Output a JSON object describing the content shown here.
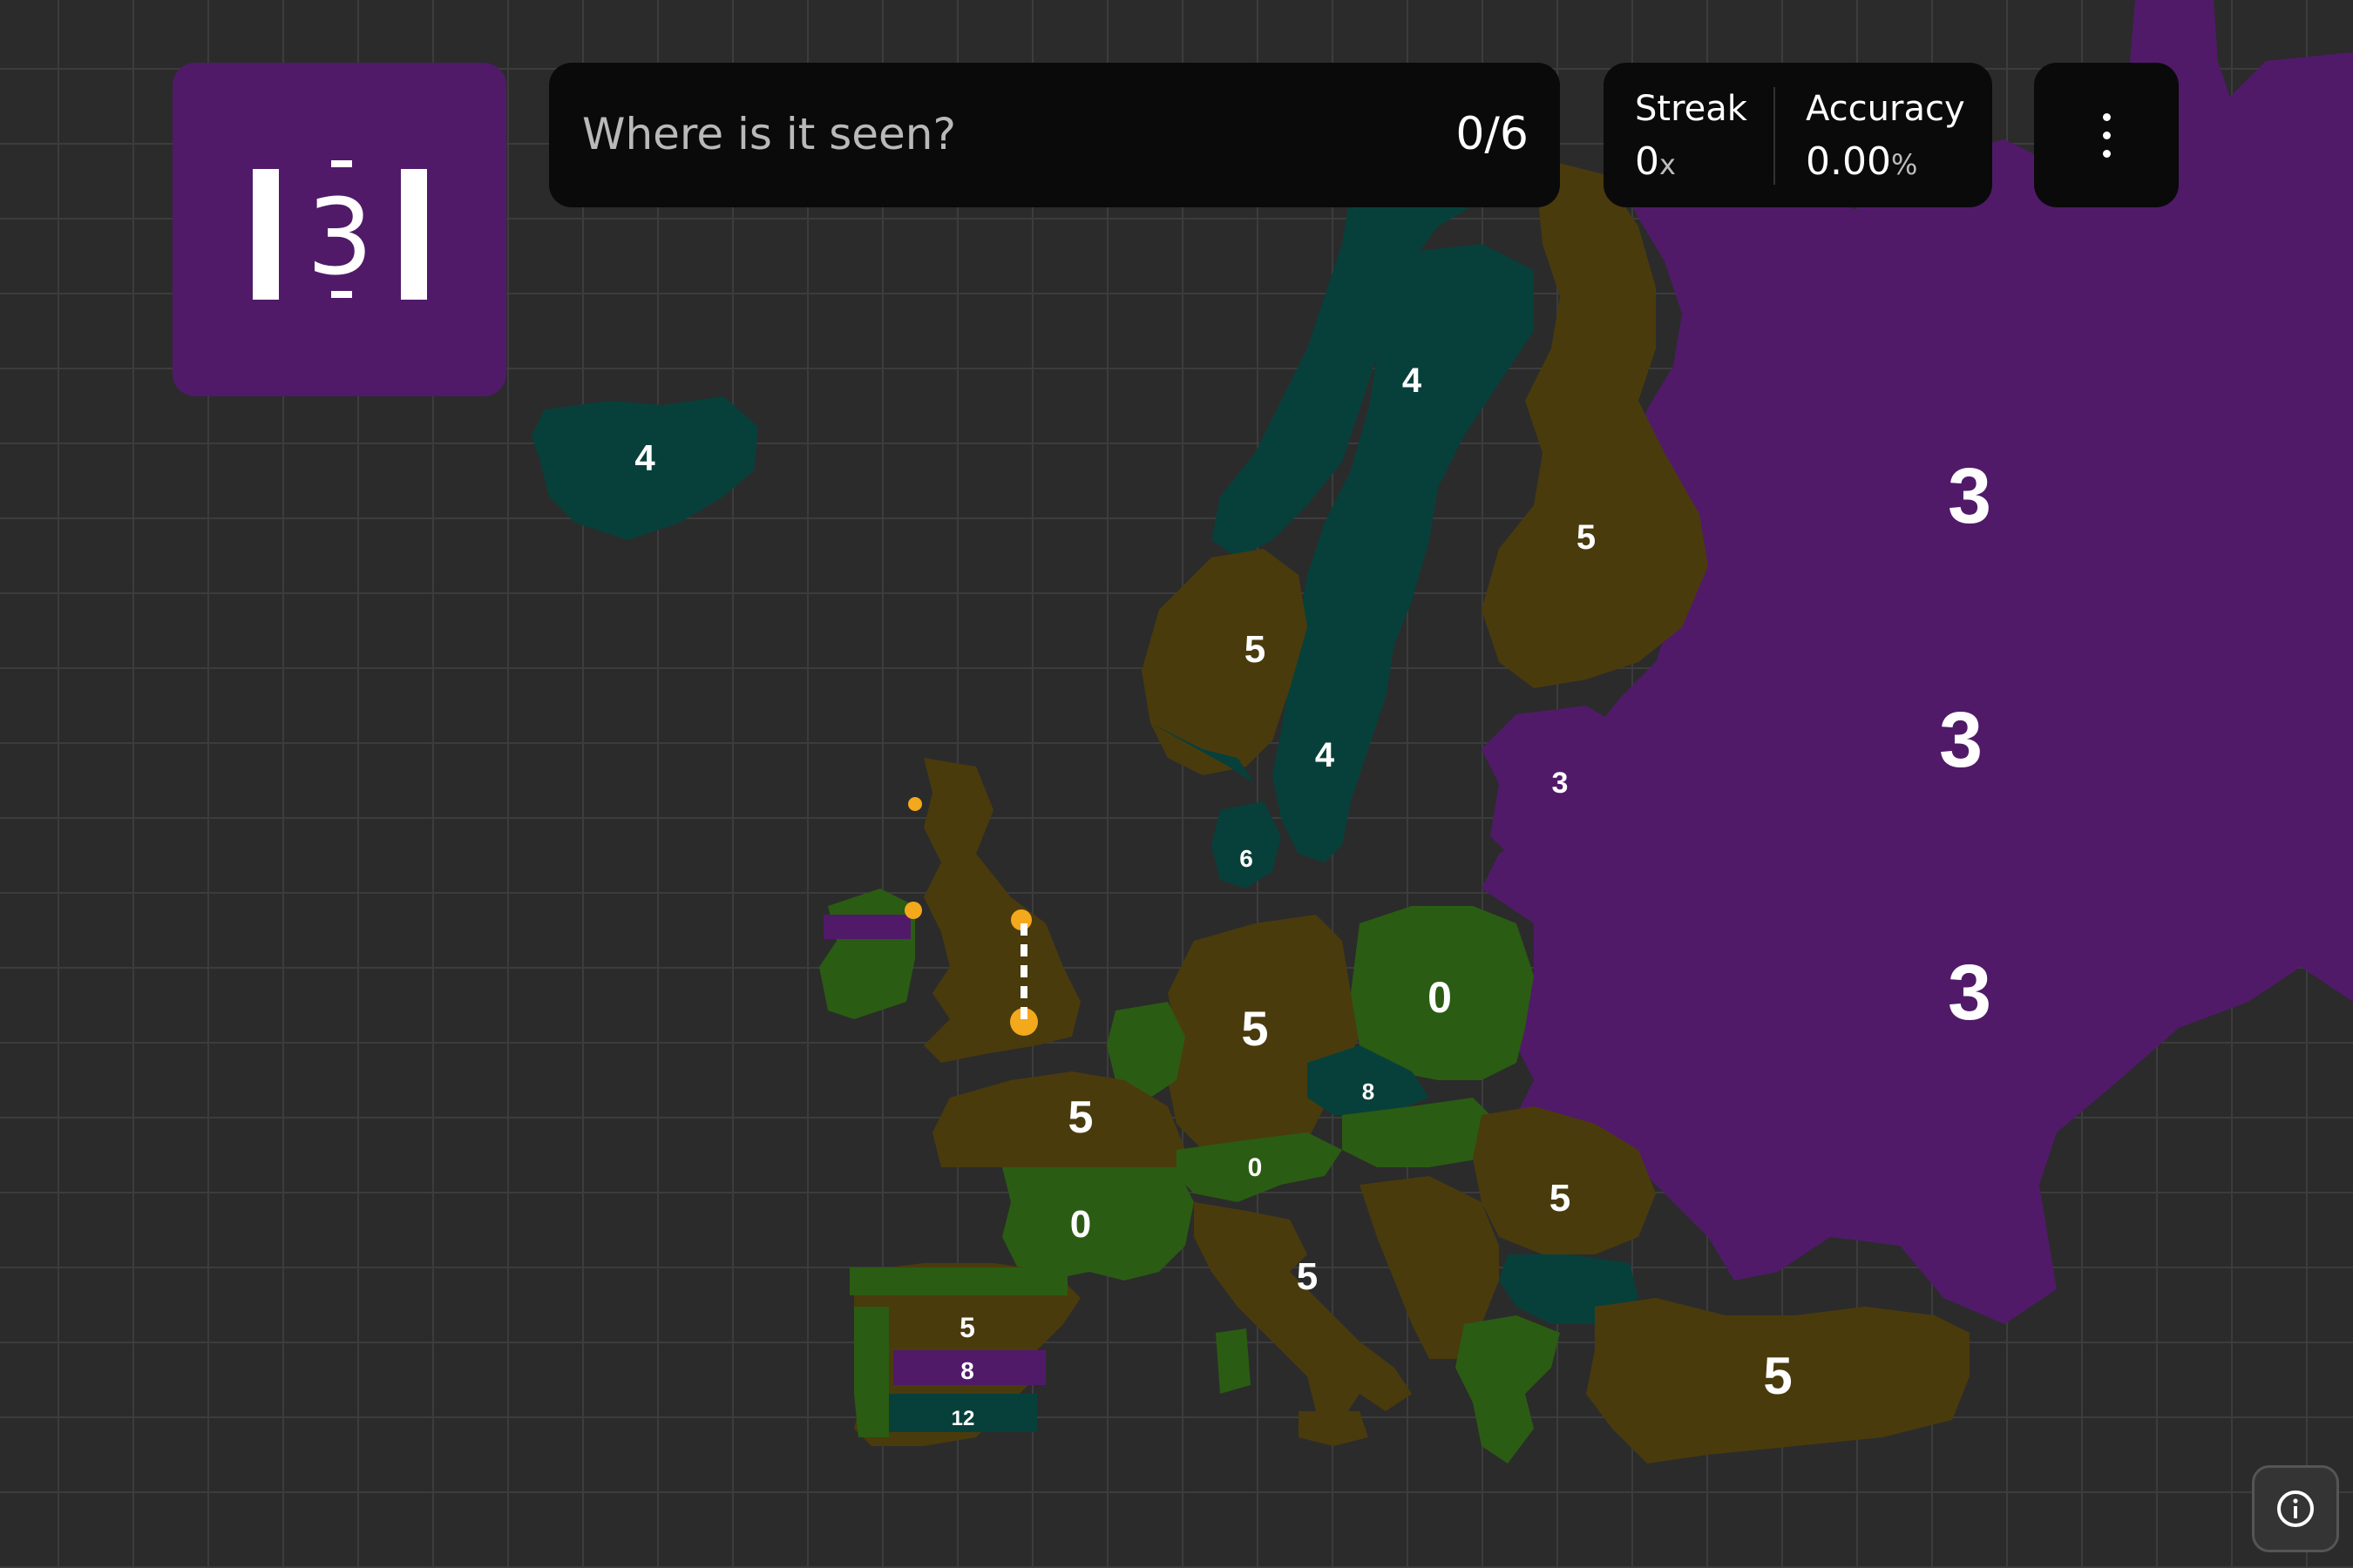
{
  "target_sign": {
    "label": "3",
    "color": "#501a69"
  },
  "search": {
    "placeholder": "Where is it seen?",
    "value": "",
    "progress": "0/6"
  },
  "stats": {
    "streak_label": "Streak",
    "streak_value": "0",
    "streak_unit": "x",
    "accuracy_label": "Accuracy",
    "accuracy_value": "0.00",
    "accuracy_unit": "%"
  },
  "menu": {
    "icon": "more-vertical-icon"
  },
  "info": {
    "icon": "info-icon"
  },
  "legend_colors": {
    "speed_3": "#501a69",
    "speed_4": "#07403a",
    "speed_5": "#4a3b0d",
    "speed_0": "#2b5c13",
    "speed_8": "#501a69",
    "speed_12": "#07403a",
    "marker": "#f4a81c"
  },
  "map_labels": {
    "iceland": "4",
    "norway_north": "4",
    "norway_south": "5",
    "sweden": "4",
    "finland": "5",
    "russia": "3",
    "baltics": "3",
    "belarus": "3",
    "ukraine": "3",
    "poland": "0",
    "germany": "5",
    "france_north": "5",
    "france_south": "0",
    "spain": "5",
    "spain_center": "8",
    "spain_south": "12",
    "turkey": "5",
    "romania": "5",
    "czechia": "8",
    "austria": "0",
    "italy": "5",
    "denmark": "6"
  }
}
